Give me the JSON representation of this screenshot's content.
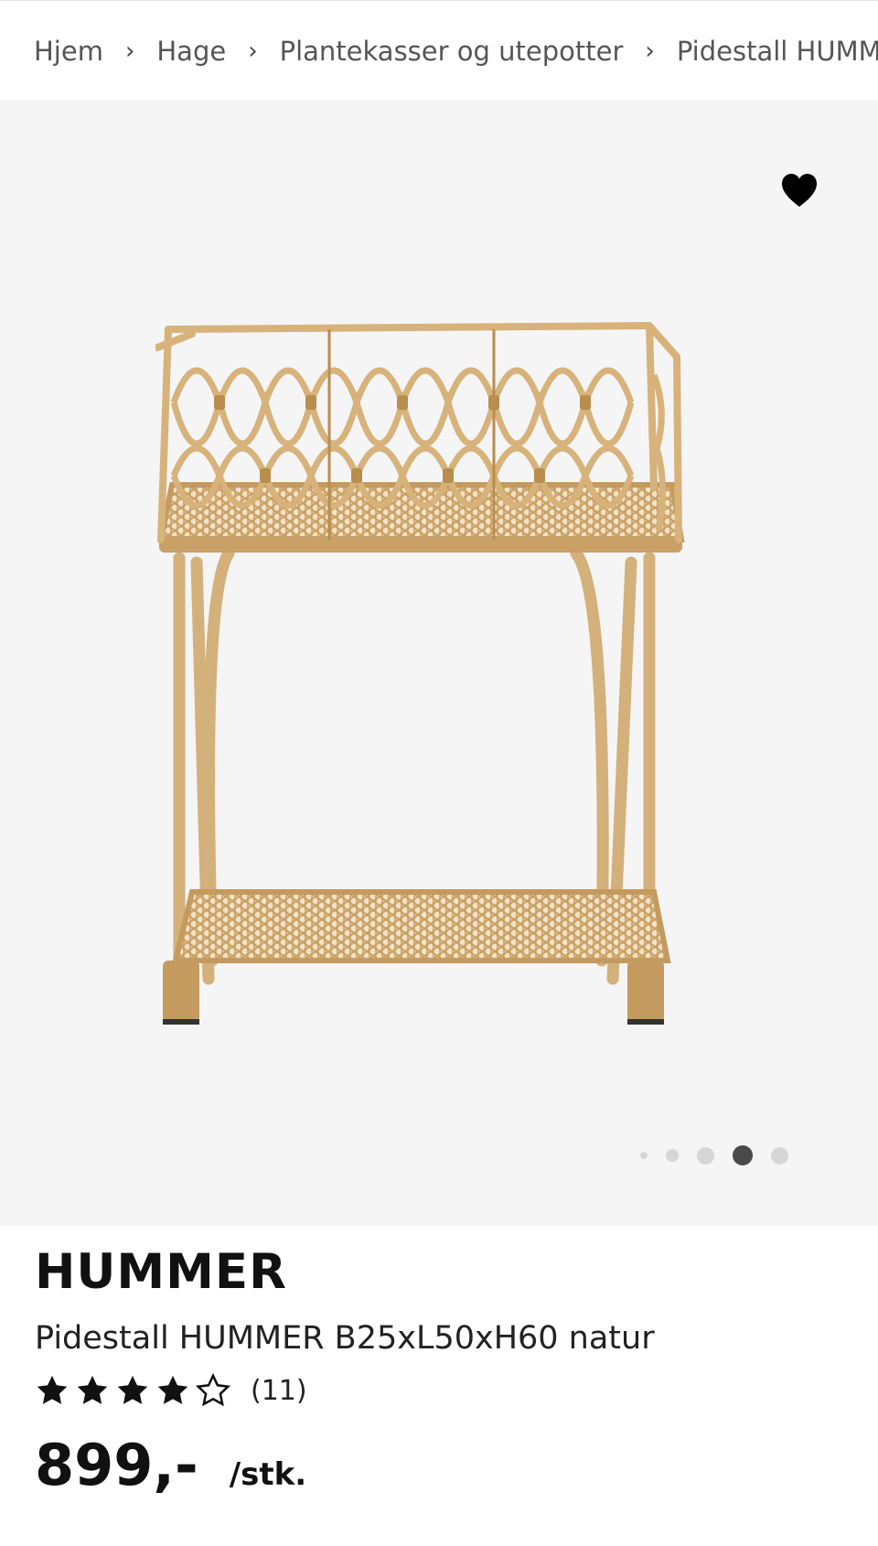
{
  "breadcrumb": {
    "items": [
      "Hjem",
      "Hage",
      "Plantekasser og utepotter",
      "Pidestall HUMMI"
    ],
    "separator": "›"
  },
  "gallery": {
    "favorite_icon": "heart-icon",
    "dot_count": 5,
    "active_index": 3,
    "background": "#f5f5f5"
  },
  "product": {
    "brand": "HUMMER",
    "name": "Pidestall HUMMER B25xL50xH60 natur",
    "rating": 4,
    "rating_max": 5,
    "review_count": "(11)",
    "price": "899,-",
    "unit": "/stk."
  },
  "colors": {
    "rattan": "#d7b27a",
    "rattan_dark": "#b98d4e"
  }
}
